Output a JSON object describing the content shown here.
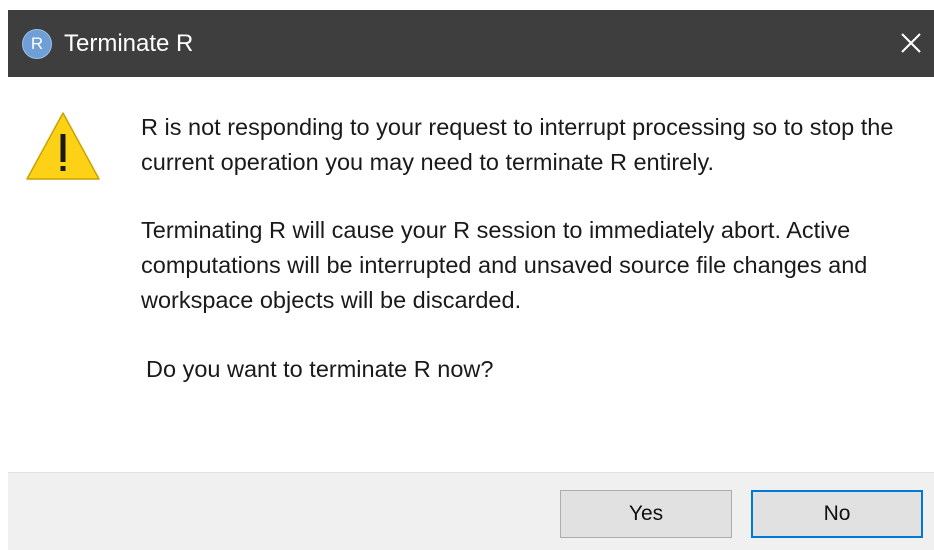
{
  "window": {
    "title": "Terminate R",
    "app_icon_letter": "R",
    "close_icon": "close-icon"
  },
  "dialog": {
    "icon": "warning-icon",
    "messages": [
      "R is not responding to your request to interrupt processing so to stop the current operation you may need to terminate R entirely.",
      "Terminating R will cause your R session to immediately abort. Active computations will be interrupted and unsaved source file changes and workspace objects will be discarded.",
      "Do you want to terminate R now?"
    ]
  },
  "buttons": {
    "yes_label": "Yes",
    "no_label": "No"
  },
  "colors": {
    "titlebar": "#3e3e3e",
    "warning_fill": "#fcd116",
    "focus_border": "#0078d7",
    "footer": "#f0f0f0"
  }
}
